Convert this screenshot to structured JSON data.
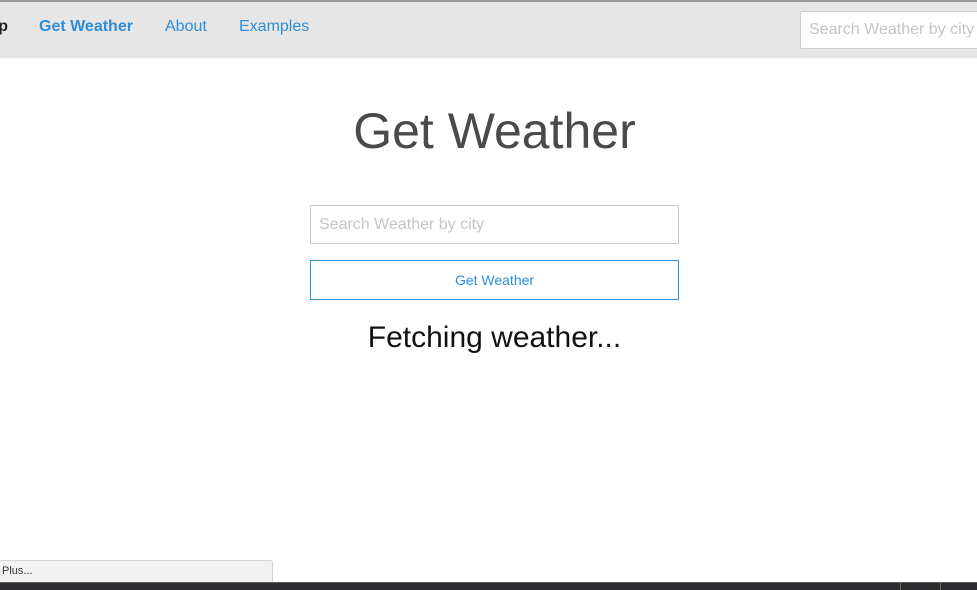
{
  "navbar": {
    "brand_fragment": "p",
    "links": [
      {
        "label": "Get Weather",
        "active": true
      },
      {
        "label": "About",
        "active": false
      },
      {
        "label": "Examples",
        "active": false
      }
    ],
    "search": {
      "placeholder": "Search Weather by city",
      "value": ""
    }
  },
  "main": {
    "title": "Get Weather",
    "city_input": {
      "placeholder": "Search Weather by city",
      "value": ""
    },
    "button_label": "Get Weather",
    "status": "Fetching weather..."
  },
  "status_tooltip": "Plus...",
  "colors": {
    "accent": "#2e8ed8",
    "navbar_bg": "#e6e6e6",
    "title": "#4a4a4a",
    "taskbar": "#2d2d30"
  }
}
